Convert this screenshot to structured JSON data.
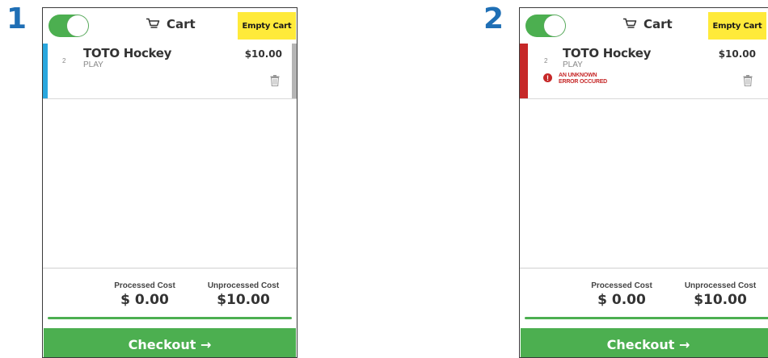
{
  "panels": [
    {
      "step": "1",
      "header": {
        "title": "Cart",
        "empty_label": "Empty Cart"
      },
      "item": {
        "qty": "2",
        "name": "TOTO Hockey",
        "type": "PLAY",
        "price": "$10.00",
        "stripe_color": "#2aa7de",
        "error": ""
      },
      "summary": {
        "processed_label": "Processed Cost",
        "processed_value": "$ 0.00",
        "unprocessed_label": "Unprocessed Cost",
        "unprocessed_value": "$10.00"
      },
      "checkout_label": "Checkout →"
    },
    {
      "step": "2",
      "header": {
        "title": "Cart",
        "empty_label": "Empty Cart"
      },
      "item": {
        "qty": "2",
        "name": "TOTO Hockey",
        "type": "PLAY",
        "price": "$10.00",
        "stripe_color": "#c62828",
        "error": "AN UNKNOWN ERROR OCCURED"
      },
      "summary": {
        "processed_label": "Processed Cost",
        "processed_value": "$ 0.00",
        "unprocessed_label": "Unprocessed Cost",
        "unprocessed_value": "$10.00"
      },
      "checkout_label": "Checkout →"
    }
  ],
  "colors": {
    "accent_green": "#4caf50",
    "empty_yellow": "#ffea3a",
    "error_red": "#c62828",
    "step_blue": "#1f6fb5"
  }
}
